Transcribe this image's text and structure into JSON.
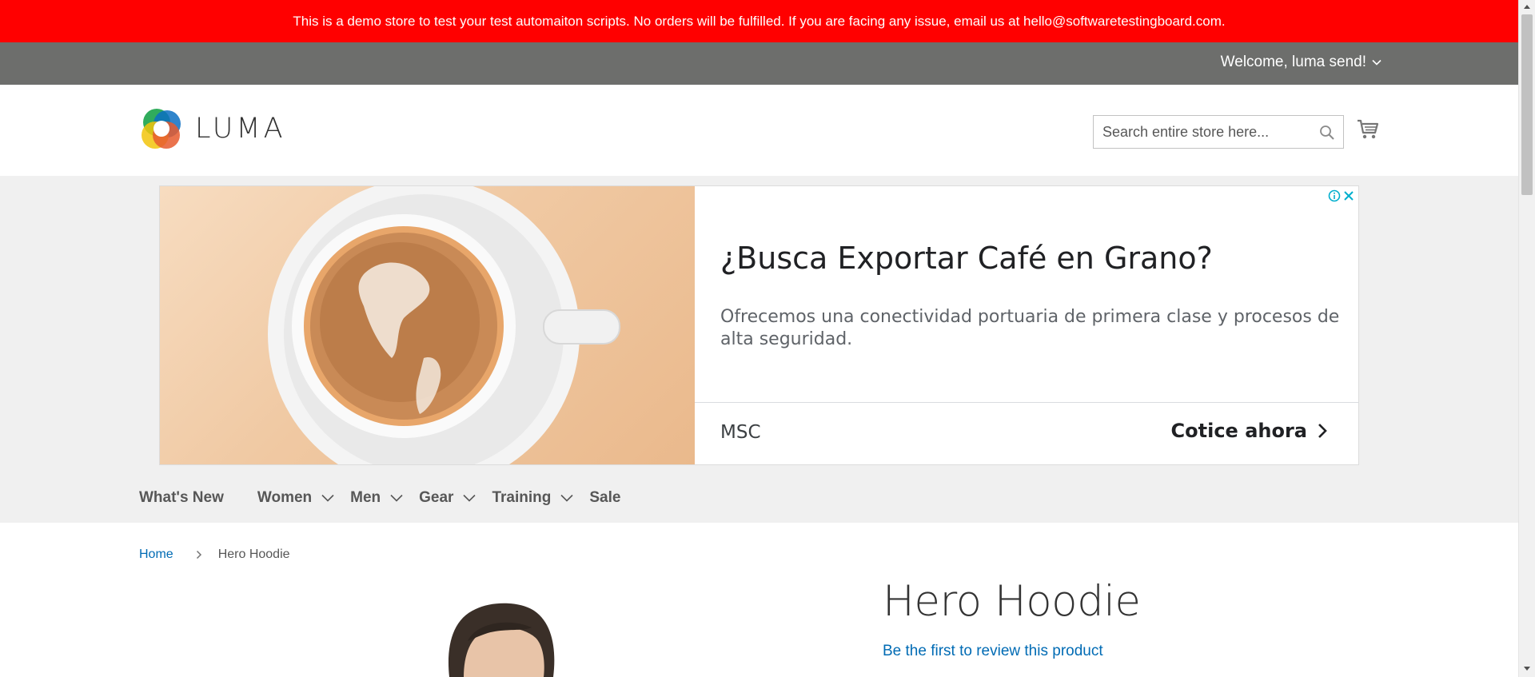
{
  "demo_notice": "This is a demo store to test your test automaiton scripts. No orders will be fulfilled. If you are facing any issue, email us at hello@softwaretestingboard.com.",
  "header": {
    "welcome": "Welcome, luma send!",
    "logo_text": "LUMA",
    "search_placeholder": "Search entire store here..."
  },
  "ad": {
    "title": "¿Busca Exportar Café en Grano?",
    "description": "Ofrecemos una conectividad portuaria de primera clase y procesos de alta seguridad.",
    "brand": "MSC",
    "cta": "Cotice ahora"
  },
  "nav": {
    "items": [
      {
        "label": "What's New",
        "has_submenu": false
      },
      {
        "label": "Women",
        "has_submenu": true
      },
      {
        "label": "Men",
        "has_submenu": true
      },
      {
        "label": "Gear",
        "has_submenu": true
      },
      {
        "label": "Training",
        "has_submenu": true
      },
      {
        "label": "Sale",
        "has_submenu": false
      }
    ]
  },
  "breadcrumb": {
    "home": "Home",
    "current": "Hero Hoodie"
  },
  "product": {
    "title": "Hero Hoodie",
    "review_link": "Be the first to review this product"
  },
  "colors": {
    "notice_bg": "#ff0000",
    "panel_bg": "#6d6e6c",
    "link": "#006bb4",
    "nav_bg": "#f0f0f0"
  }
}
